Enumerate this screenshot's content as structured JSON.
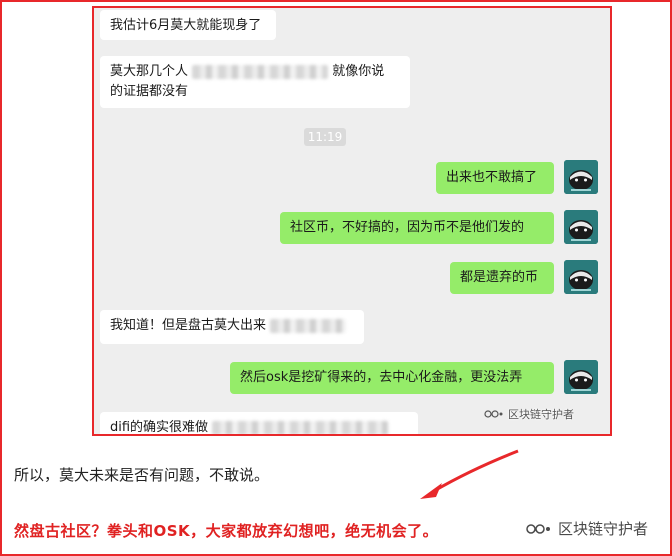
{
  "chat": {
    "messages": [
      {
        "side": "left",
        "text": "我估计6月莫大就能现身了"
      },
      {
        "side": "left",
        "text_a": "莫大那几个人",
        "text_b": "就像你说",
        "text_c": "的证据都没有"
      },
      {
        "side": "right",
        "text": "出来也不敢搞了"
      },
      {
        "side": "right",
        "text": "社区币，不好搞的，因为币不是他们发的"
      },
      {
        "side": "right",
        "text": "都是遗弃的币"
      },
      {
        "side": "left",
        "text": "我知道！但是盘古莫大出来"
      },
      {
        "side": "right",
        "text": "然后osk是挖矿得来的，去中心化金融，更没法弄"
      },
      {
        "side": "left",
        "text": "difi的确实很难做"
      }
    ],
    "timestamp": "11:19",
    "watermark": "区块链守护者",
    "avatar_icon": "honey-badger-icon"
  },
  "article": {
    "body": "所以，莫大未来是否有问题，不敢说。",
    "headline": "然盘古社区？拳头和OSK，大家都放弃幻想吧，绝无机会了。",
    "watermark": "区块链守护者"
  },
  "colors": {
    "accent_red": "#e8282b",
    "bubble_green": "#95ec69",
    "headline_red": "#e02222"
  }
}
